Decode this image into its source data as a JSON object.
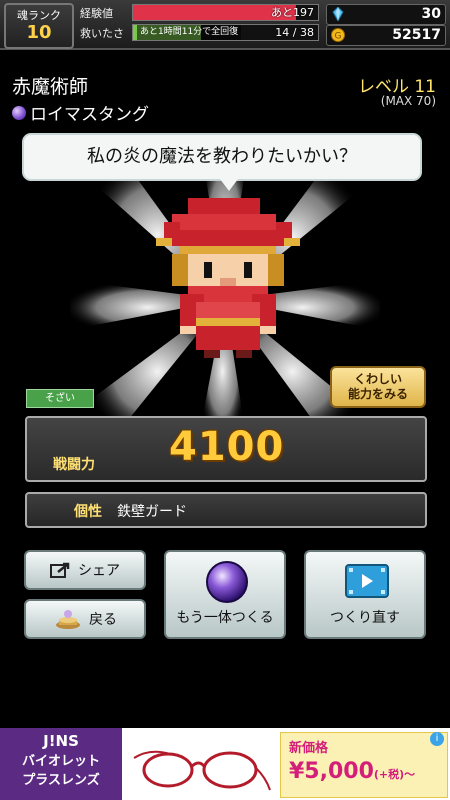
{
  "hud": {
    "rank_label": "魂ランク",
    "rank_value": "10",
    "exp_label": "経験値",
    "exp_text": "あと197",
    "exp_progress": 0.88,
    "rescue_label": "救いたさ",
    "rescue_sub": "あと1時間11分で全回復",
    "rescue_text": "14 / 38",
    "rescue_progress": 0.37,
    "gems": "30",
    "coins": "52517"
  },
  "character": {
    "class_name": "赤魔術師",
    "title": "ロイマスタング",
    "level": "レベル 11",
    "level_max": "(MAX 70)",
    "speech": "私の炎の魔法を教わりたいかい？",
    "tag": "そざい",
    "detail_line1": "くわしい",
    "detail_line2": "能力をみる"
  },
  "power": {
    "label": "戦闘力",
    "value": "4100"
  },
  "trait": {
    "label": "個性",
    "value": "鉄壁ガード"
  },
  "buttons": {
    "share": "シェア",
    "back": "戻る",
    "make_another": "もう一体つくる",
    "remake": "つくり直す"
  },
  "ad": {
    "brand": "J!NS",
    "line1": "バイオレット",
    "line2": "プラスレンズ",
    "new_price": "新価格",
    "price": "¥5,000",
    "tax": "(+税)～",
    "info": "i"
  },
  "colors": {
    "exp_bar": "#e0334a",
    "rescue_bar": "#7bc94c",
    "gold": "#ffcb3a",
    "ad_purple": "#5b2a82"
  }
}
